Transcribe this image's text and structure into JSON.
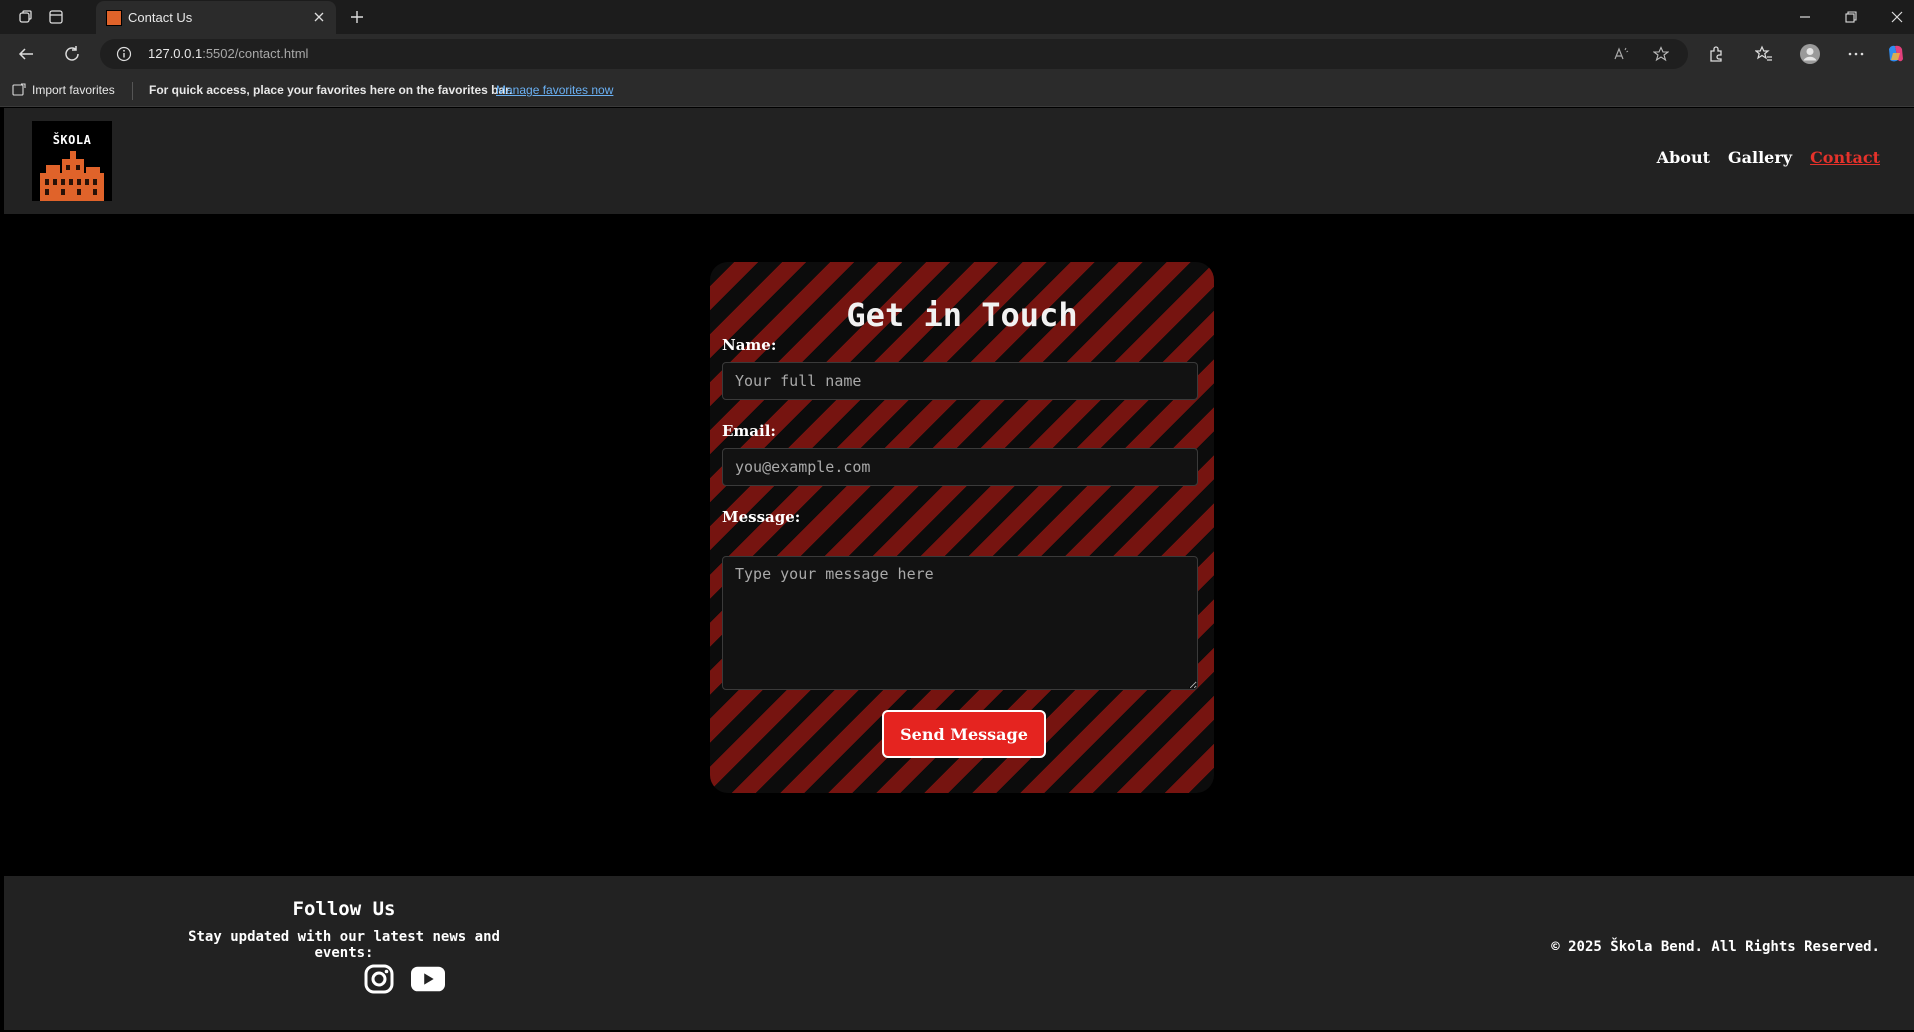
{
  "browser": {
    "tab_title": "Contact Us",
    "url_host": "127.0.0.1",
    "url_path": ":5502/contact.html",
    "favorites": {
      "import_label": "Import favorites",
      "message": "For quick access, place your favorites here on the favorites bar.",
      "manage_link": "Manage favorites now"
    }
  },
  "header": {
    "logo_text": "ŠKOLA",
    "nav": [
      {
        "label": "About",
        "active": false
      },
      {
        "label": "Gallery",
        "active": false
      },
      {
        "label": "Contact",
        "active": true
      }
    ]
  },
  "contact_form": {
    "title": "Get in Touch",
    "name_label": "Name:",
    "name_placeholder": "Your full name",
    "email_label": "Email:",
    "email_placeholder": "you@example.com",
    "message_label": "Message:",
    "message_placeholder": "Type your message here",
    "submit_label": "Send Message"
  },
  "footer": {
    "follow_title": "Follow Us",
    "follow_subtitle": "Stay updated with our latest news and events:",
    "social": [
      {
        "icon": "instagram-icon"
      },
      {
        "icon": "youtube-icon"
      }
    ],
    "copyright": "© 2025 Škola Bend. All Rights Reserved."
  },
  "colors": {
    "accent_red": "#e52420",
    "stripe_red": "#761410",
    "header_bg": "#222222",
    "page_bg": "#000000"
  }
}
